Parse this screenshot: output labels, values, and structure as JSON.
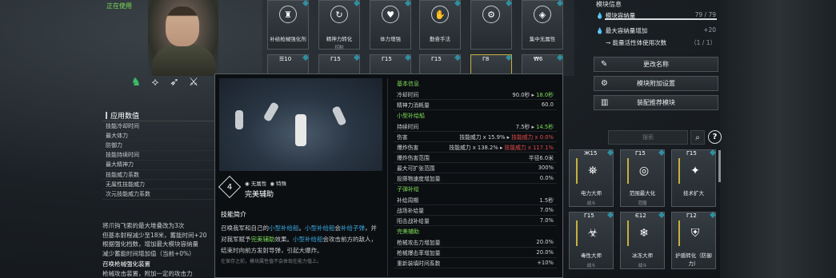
{
  "status": "正在使用",
  "character": {
    "badges": [
      "♞",
      "⟡",
      "➶",
      "⚔"
    ]
  },
  "stats": {
    "header": "应用数值",
    "rows": [
      "技能冷却时间",
      "最大体力",
      "防御力",
      "技能持续时间",
      "最大精神力",
      "技能威力系数",
      "无属性技能威力",
      "次元技能威力系数"
    ]
  },
  "notes": [
    "将爪钩飞索的最大堆叠改为3次",
    "但基本射程减少至18米，蓄能时间+20",
    "根据强化档数，增加最大模块容纳量",
    "减少蓄能时间增加值（当前+0%）",
    "召唤枪械强化装置",
    "枪械攻击装置，附加一定的攻击力"
  ],
  "modules_top": [
    {
      "label": "补给枪械强化剂",
      "sub": "",
      "tag": "",
      "icon": "♜"
    },
    {
      "label": "精神力转化",
      "sub": "控制",
      "tag": "",
      "icon": "↻"
    },
    {
      "label": "体力增强",
      "sub": "",
      "tag": "",
      "icon": "♥"
    },
    {
      "label": "勤奋手法",
      "sub": "",
      "tag": "",
      "icon": "✋"
    },
    {
      "label": "",
      "sub": "",
      "tag": "",
      "icon": "⚙"
    },
    {
      "label": "集中无属性",
      "sub": "",
      "tag": "",
      "icon": "◈"
    }
  ],
  "modules_row2": [
    "☰10",
    "Γ15",
    "Γ15",
    "Γ15",
    "Γ8",
    "₩6"
  ],
  "right_panel": {
    "title": "模块信息",
    "capacity_label": "模块容纳量",
    "capacity_value": "79 / 79",
    "increase_label": "最大容纳量增加",
    "increase_value": "+20",
    "energy_label": "能量活性体使用次数",
    "energy_value": "（1 / 1）",
    "buttons": [
      "更改名称",
      "模块附加设置",
      "装配推荐模块"
    ]
  },
  "search": {
    "placeholder": "搜索"
  },
  "grid_modules": [
    {
      "tag": "Ж15",
      "label": "电力大师",
      "sub": "战斗"
    },
    {
      "tag": "Γ15",
      "label": "范围最大化",
      "sub": "范围"
    },
    {
      "tag": "Γ15",
      "label": "技术扩大",
      "sub": ""
    },
    {
      "tag": "Γ15",
      "label": "毒性大师",
      "sub": "战斗"
    },
    {
      "tag": "Є12",
      "label": "冰冻大师",
      "sub": "战斗"
    },
    {
      "tag": "Γ12",
      "label": "护盾转化（防御力）",
      "sub": ""
    }
  ],
  "tooltip": {
    "tier": "4",
    "attr1": "无属性",
    "attr2": "特殊",
    "name": "完美辅助",
    "section": "技能简介",
    "desc_parts": [
      "召唤我军和自己的",
      "小型补给船",
      "。",
      "小型补给船",
      "会",
      "补给子弹",
      "，并对我军赋予",
      "完美辅助",
      "效果。",
      "小型补给船",
      "会攻击前方的敌人，结束时向前方发射导弹，引起大爆炸。"
    ],
    "note": "在保存之前，模块属性值不会体现在能力值上。",
    "table": [
      {
        "type": "sec",
        "label": "基本信息"
      },
      {
        "type": "row",
        "label": "冷却时间",
        "v1": "90.0秒",
        "v2": "18.0秒",
        "c2": "gr"
      },
      {
        "type": "row",
        "label": "精神力消耗量",
        "v1": "60.0",
        "v2": "",
        "c2": ""
      },
      {
        "type": "sec",
        "label": "小型补给船"
      },
      {
        "type": "row",
        "label": "持续时间",
        "v1": "7.5秒",
        "v2": "14.5秒",
        "c2": "gr"
      },
      {
        "type": "row",
        "label": "伤害",
        "v1": "技能威力 x 15.9%",
        "v2": "技能威力 x 0.0%",
        "c2": "rd"
      },
      {
        "type": "row",
        "label": "爆炸伤害",
        "v1": "技能威力 x 138.2%",
        "v2": "技能威力 x 117.1%",
        "c2": "rd"
      },
      {
        "type": "row",
        "label": "爆炸伤害范围",
        "v1": "半径6.0米",
        "v2": "",
        "c2": ""
      },
      {
        "type": "row",
        "label": "最大可扩张范围",
        "v1": "300%",
        "v2": "",
        "c2": ""
      },
      {
        "type": "row",
        "label": "投掷物速度增加量",
        "v1": "0.0%",
        "v2": "",
        "c2": ""
      },
      {
        "type": "sec",
        "label": "子弹补给"
      },
      {
        "type": "row",
        "label": "补给周期",
        "v1": "1.5秒",
        "v2": "",
        "c2": ""
      },
      {
        "type": "row",
        "label": "战场补给量",
        "v1": "7.0%",
        "v2": "",
        "c2": ""
      },
      {
        "type": "row",
        "label": "阳击战补给量",
        "v1": "7.0%",
        "v2": "",
        "c2": ""
      },
      {
        "type": "sec",
        "label": "完美辅助"
      },
      {
        "type": "row",
        "label": "枪械攻击力增加量",
        "v1": "20.0%",
        "v2": "",
        "c2": ""
      },
      {
        "type": "row",
        "label": "枪械爆击率增加量",
        "v1": "20.0%",
        "v2": "",
        "c2": ""
      },
      {
        "type": "row",
        "label": "重新装填时间系数",
        "v1": "+10%",
        "v2": "",
        "c2": ""
      }
    ]
  }
}
